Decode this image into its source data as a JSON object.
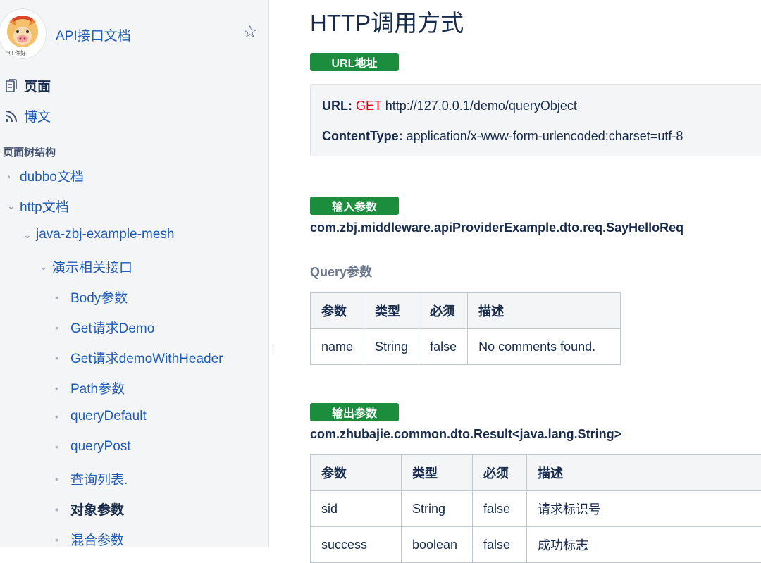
{
  "sidebar": {
    "space_name": "API接口文档",
    "avatar_text": "Hi! 你好",
    "nav": {
      "pages": "页面",
      "blog": "博文"
    },
    "tree_heading": "页面树结构",
    "tree": [
      {
        "label": "dubbo文档",
        "level": 0,
        "marker": "›"
      },
      {
        "label": "http文档",
        "level": 0,
        "marker": "⌄"
      },
      {
        "label": "java-zbj-example-mesh",
        "level": 1,
        "marker": "⌄"
      },
      {
        "label": "演示相关接口",
        "level": 2,
        "marker": "⌄"
      },
      {
        "label": "Body参数",
        "level": 3,
        "marker": "•"
      },
      {
        "label": "Get请求Demo",
        "level": 3,
        "marker": "•"
      },
      {
        "label": "Get请求demoWithHeader",
        "level": 3,
        "marker": "•"
      },
      {
        "label": "Path参数",
        "level": 3,
        "marker": "•"
      },
      {
        "label": "queryDefault",
        "level": 3,
        "marker": "•"
      },
      {
        "label": "queryPost",
        "level": 3,
        "marker": "•"
      },
      {
        "label": "查询列表.",
        "level": 3,
        "marker": "•"
      },
      {
        "label": "对象参数",
        "level": 3,
        "marker": "•",
        "current": true
      },
      {
        "label": "混合参数",
        "level": 3,
        "marker": "•"
      }
    ]
  },
  "main": {
    "title": "HTTP调用方式",
    "url_badge": "URL地址",
    "url_label": "URL:",
    "method": "GET",
    "url": "http://127.0.0.1/demo/queryObject",
    "content_type_label": "ContentType:",
    "content_type": "application/x-www-form-urlencoded;charset=utf-8",
    "input_badge": "输入参数",
    "input_class": "com.zbj.middleware.apiProviderExample.dto.req.SayHelloReq",
    "query_sub": "Query参数",
    "query_table": {
      "headers": [
        "参数",
        "类型",
        "必须",
        "描述"
      ],
      "rows": [
        [
          "name",
          "String",
          "false",
          "No comments found."
        ]
      ]
    },
    "output_badge": "输出参数",
    "output_class": "com.zhubajie.common.dto.Result<java.lang.String>",
    "output_table": {
      "headers": [
        "参数",
        "类型",
        "必须",
        "描述"
      ],
      "rows": [
        [
          "sid",
          "String",
          "false",
          "请求标识号"
        ],
        [
          "success",
          "boolean",
          "false",
          "成功标志"
        ]
      ]
    }
  },
  "colors": {
    "badge": "#1c8d3c",
    "link": "#1e5bb8",
    "method": "#e60012"
  }
}
